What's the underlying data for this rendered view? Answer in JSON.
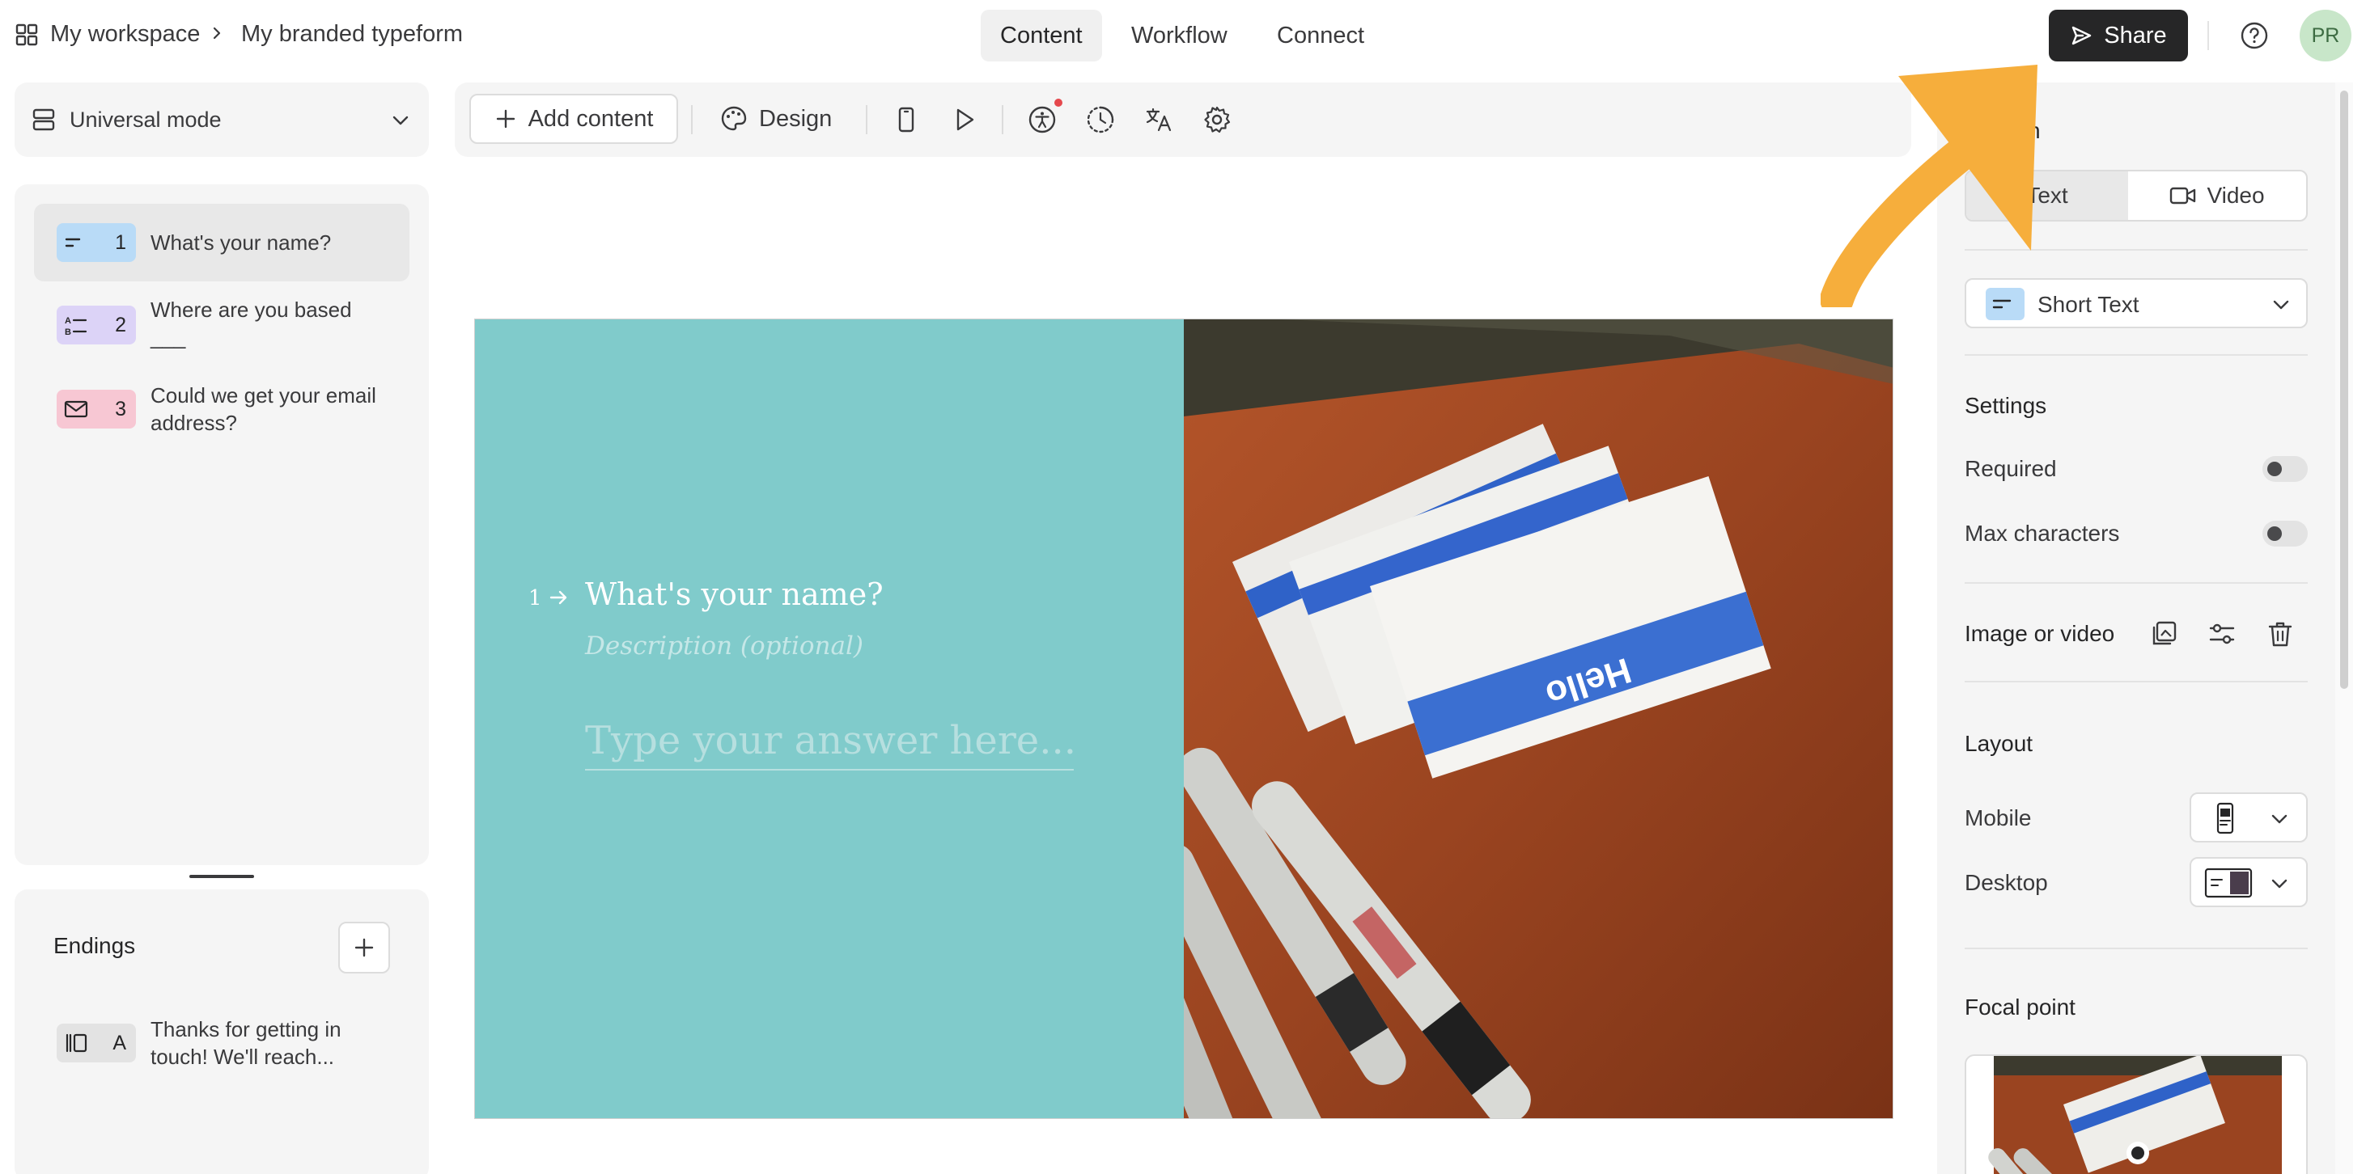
{
  "header": {
    "workspace": "My workspace",
    "form_name": "My branded typeform",
    "tabs": [
      {
        "label": "Content",
        "active": true
      },
      {
        "label": "Workflow",
        "active": false
      },
      {
        "label": "Connect",
        "active": false
      }
    ],
    "share_label": "Share",
    "avatar_initials": "PR"
  },
  "sidebar": {
    "mode_label": "Universal mode",
    "questions": [
      {
        "number": "1",
        "text": "What's your name?",
        "type_icon": "short-text-icon",
        "badge_color": "#b9dbf7"
      },
      {
        "number": "2",
        "text": "Where are you based",
        "subtext": "___",
        "type_icon": "multiple-choice-icon",
        "badge_color": "#dcd3f7"
      },
      {
        "number": "3",
        "text": "Could we get your email address?",
        "type_icon": "email-icon",
        "badge_color": "#f7c7d3"
      }
    ],
    "endings_title": "Endings",
    "endings": [
      {
        "letter": "A",
        "text": "Thanks for getting in touch! We'll reach...",
        "type_icon": "ending-icon",
        "badge_color": "#e3e3e3"
      }
    ]
  },
  "toolbar": {
    "add_content_label": "Add content",
    "design_label": "Design"
  },
  "canvas": {
    "question_number": "1",
    "question_title": "What's your name?",
    "description_placeholder": "Description (optional)",
    "answer_placeholder": "Type your answer here...",
    "background_color": "#80cbcb"
  },
  "right_panel": {
    "question_heading_partial": "n",
    "seg_text_label": "Text",
    "seg_video_label": "Video",
    "question_type": "Short Text",
    "settings_heading": "Settings",
    "required_label": "Required",
    "required_on": false,
    "max_chars_label": "Max characters",
    "max_chars_on": false,
    "image_video_label": "Image or video",
    "layout_heading": "Layout",
    "mobile_label": "Mobile",
    "desktop_label": "Desktop",
    "focal_heading": "Focal point"
  },
  "colors": {
    "accent_dark": "#262627",
    "annotation_arrow": "#f6ae3c"
  }
}
